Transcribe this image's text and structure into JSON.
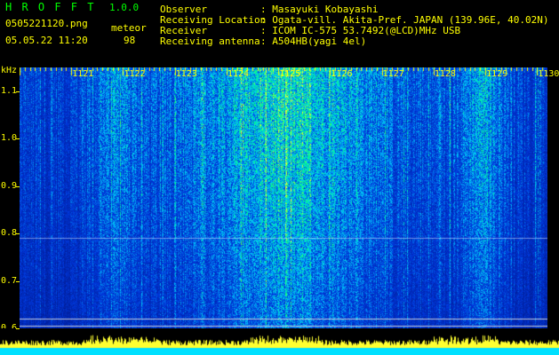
{
  "app": {
    "name": "H R O F F T",
    "version": "1.0.0",
    "filename": "0505221120.png",
    "mode": "meteor",
    "datetime": "05.05.22 11:20",
    "count": "98"
  },
  "info": {
    "labels": [
      "Observer",
      "Receiving Location",
      "Receiver",
      "Receiving antenna"
    ],
    "values": [
      ": Masayuki Kobayashi",
      ": Ogata-vill. Akita-Pref. JAPAN (139.96E, 40.02N)",
      ": ICOM IC-575 53.7492(@LCD)MHz USB",
      ": A504HB(yagi 4el)"
    ]
  },
  "colors": {
    "title_green": "#00ff00",
    "text_yellow": "#ffff00",
    "text_white": "#ffffff",
    "bg_blue": "#001078",
    "baseline_cyan": "#00e0ff"
  },
  "chart_data": {
    "type": "heatmap",
    "ylabel": "kHz",
    "yticks": [
      "1.1",
      "1.0",
      "0.9",
      "0.8",
      "0.7",
      "0.6"
    ],
    "yrange": [
      0.6,
      1.15
    ],
    "xticks": [
      "1121",
      "1122",
      "1123",
      "1124",
      "1125",
      "1126",
      "1127",
      "1128",
      "1129",
      "1130"
    ],
    "xrange": [
      1120,
      1130.2
    ]
  }
}
